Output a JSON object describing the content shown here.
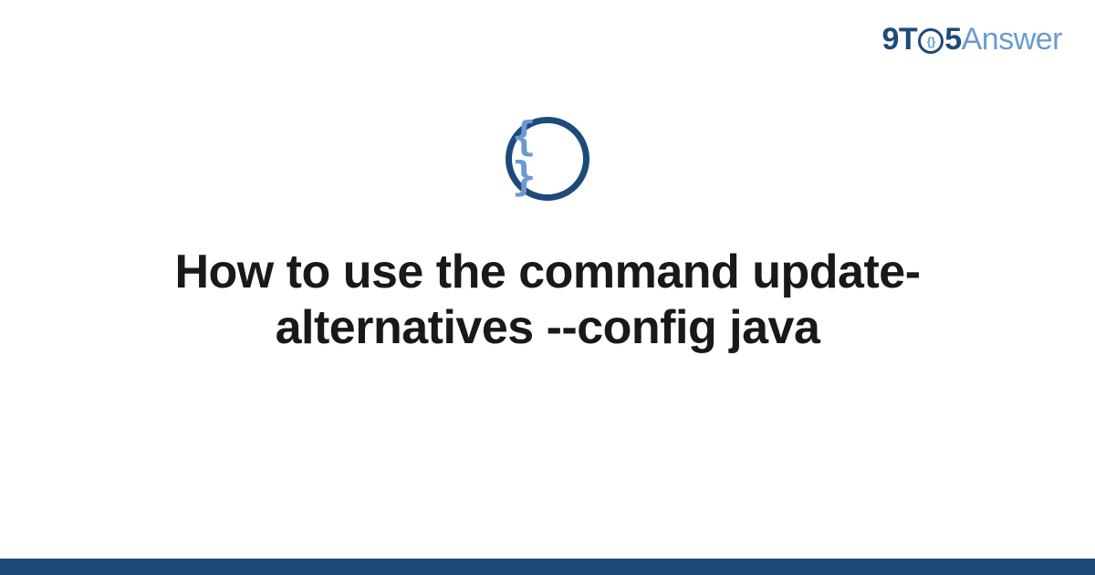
{
  "logo": {
    "nine": "9",
    "t": "T",
    "o_inner": "{}",
    "five": "5",
    "answer": "Answer"
  },
  "badge": {
    "braces": "{ }"
  },
  "title": "How to use the command update-alternatives --config java",
  "colors": {
    "primary": "#1e4a7a",
    "accent": "#6a9bd1",
    "text": "#18191a"
  }
}
